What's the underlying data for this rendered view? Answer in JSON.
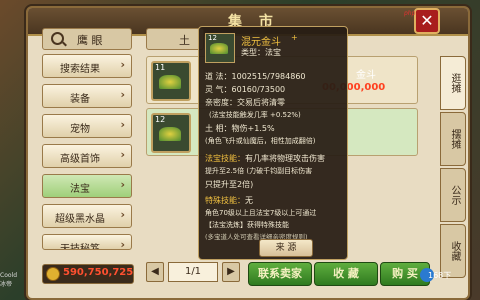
{
  "window": {
    "title": "集 市"
  },
  "sidebar": {
    "header": "鹰 眼",
    "items": [
      {
        "label": "搜索结果"
      },
      {
        "label": "装备"
      },
      {
        "label": "宠物"
      },
      {
        "label": "高级首饰"
      },
      {
        "label": "法宝",
        "selected": true
      },
      {
        "label": "超级黑水晶"
      },
      {
        "label": "天技秘笈"
      }
    ]
  },
  "gold": {
    "value": "590,750,725"
  },
  "list": {
    "header_partial": "土",
    "rows": [
      {
        "level": "11",
        "name_partial": "金斗",
        "price_partial": "00,000,000"
      },
      {
        "level": "12",
        "name_partial": "",
        "price_partial": ""
      }
    ]
  },
  "tooltip": {
    "level": "12",
    "name": "混元金斗",
    "name_suffix": "+",
    "type": "类型：法宝",
    "lines": [
      "道  法：1002515/7984860",
      "灵  气：60160/73500",
      "亲密度：交易后将清零",
      "(法宝技能触发几率 +0.52%)",
      "土  相：物伤+1.5%",
      "(角色飞升或仙魔后，相性加成翻倍)"
    ],
    "skill_title": "法宝技能：",
    "skill_lines": [
      "有几率将物理攻击伤害",
      "提升至2.5倍 (力破千钧副目标伤害",
      "只提升至2倍)"
    ],
    "special_title": "特殊技能：",
    "special_value": "无",
    "special_lines": [
      "角色70级以上且法宝7级以上可通过",
      "【法宝洗炼】获得特殊技能",
      "(多宝道人处可查看详细亲密度规则)"
    ],
    "source_button": "来  源"
  },
  "tabs": [
    {
      "label": "逛摊",
      "selected": true
    },
    {
      "label": "摆摊"
    },
    {
      "label": "公示"
    },
    {
      "label": "收藏"
    }
  ],
  "pager": {
    "prev": "◀",
    "value": "1/1",
    "next": "▶"
  },
  "buttons": {
    "contact": "联系卖家",
    "favorite": "收 藏",
    "buy": "购 买"
  },
  "chat": {
    "line1": "Coold",
    "line2": "冰帝"
  },
  "watermark": "168下"
}
